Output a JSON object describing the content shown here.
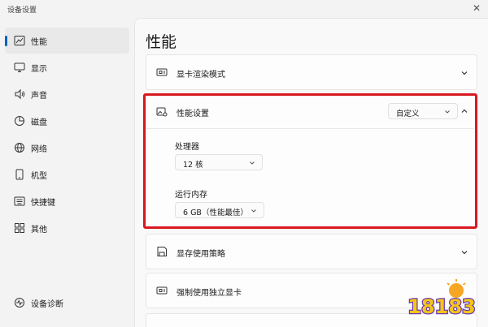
{
  "window": {
    "title": "设备设置",
    "close_glyph": "✕"
  },
  "sidebar": {
    "items": [
      {
        "label": "性能",
        "icon": "performance-chart-icon",
        "active": true
      },
      {
        "label": "显示",
        "icon": "monitor-icon"
      },
      {
        "label": "声音",
        "icon": "speaker-icon"
      },
      {
        "label": "磁盘",
        "icon": "disk-pie-icon"
      },
      {
        "label": "网络",
        "icon": "globe-icon"
      },
      {
        "label": "机型",
        "icon": "device-icon"
      },
      {
        "label": "快捷键",
        "icon": "keyboard-icon"
      },
      {
        "label": "其他",
        "icon": "grid-icon"
      }
    ],
    "footer": {
      "label": "设备诊断",
      "icon": "diagnostics-icon"
    }
  },
  "main": {
    "page_title": "性能",
    "gpu_render_mode": {
      "label": "显卡渲染模式",
      "icon": "gpu-card-icon"
    },
    "performance_settings": {
      "label": "性能设置",
      "icon": "image-settings-icon",
      "mode_value": "自定义",
      "processor": {
        "label": "处理器",
        "value": "12 核"
      },
      "memory": {
        "label": "运行内存",
        "value": "6 GB（性能最佳）"
      }
    },
    "storage_strategy": {
      "label": "显存使用策略",
      "icon": "save-icon"
    },
    "force_dedicated_gpu": {
      "label": "强制使用独立显卡",
      "icon": "gpu-card-icon"
    }
  },
  "watermark": {
    "text": "18183",
    "accent_color": "#f5a623",
    "brand_color": "#6a3bb5"
  },
  "colors": {
    "accent": "#005fb8",
    "highlight_border": "#d71920"
  }
}
